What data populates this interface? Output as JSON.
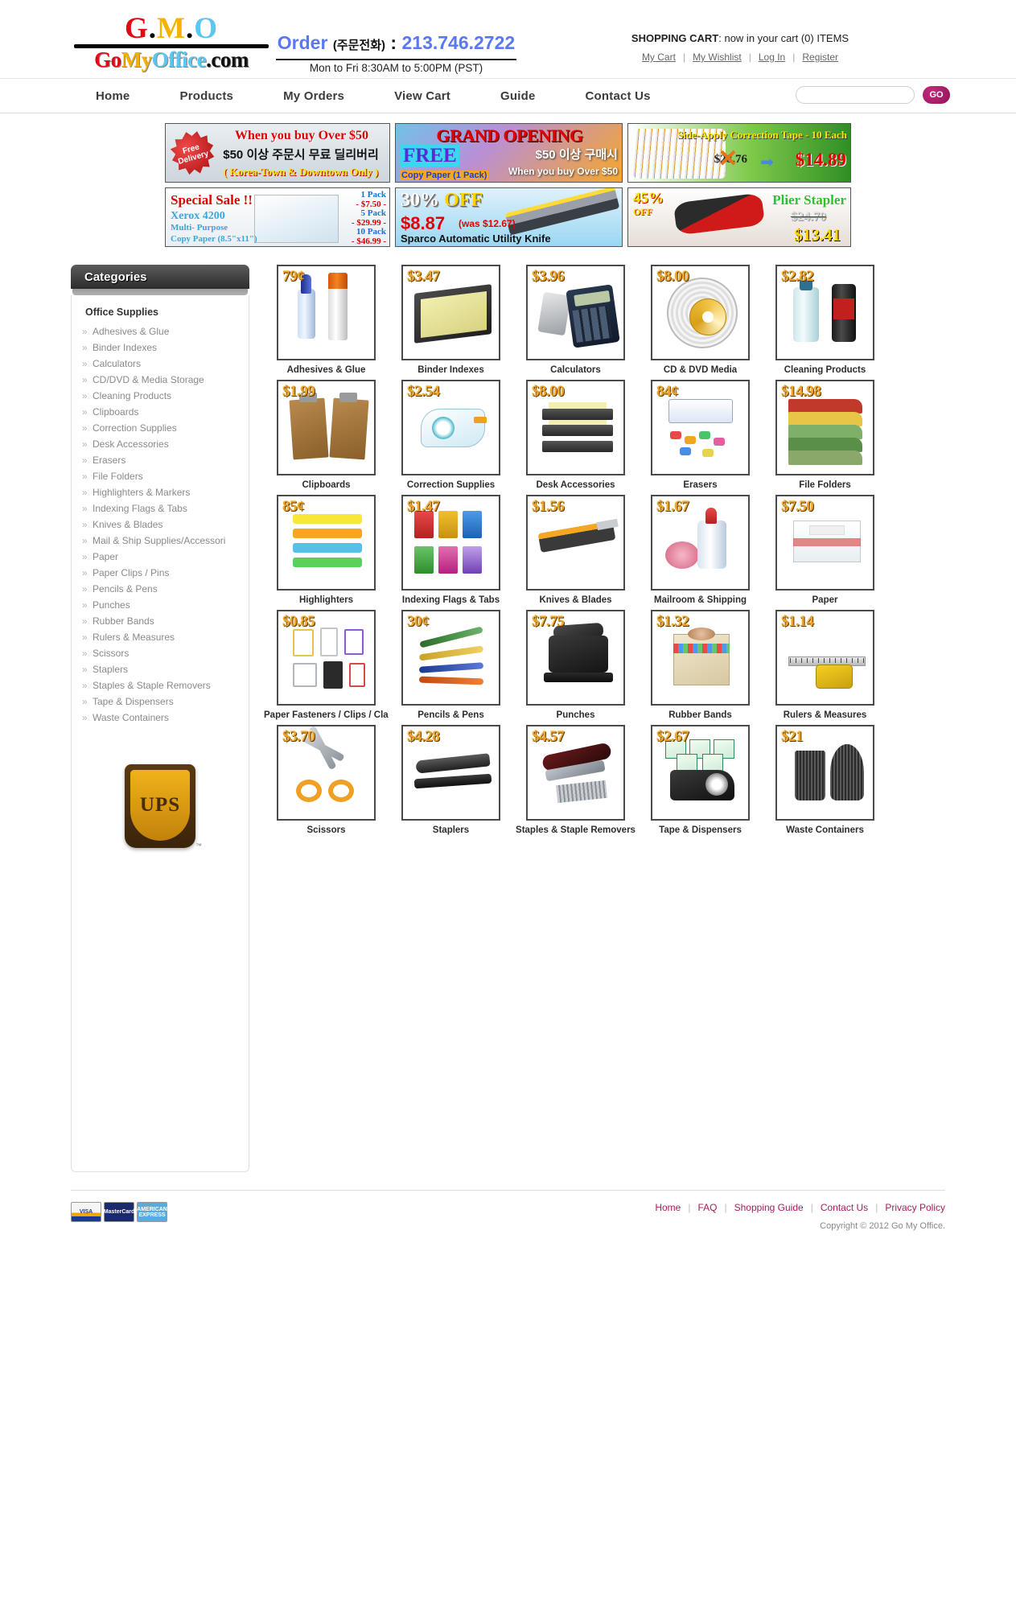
{
  "header": {
    "logo_top": "G.M.O",
    "logo_bottom": "GoMyOffice.com",
    "order_label": "Order",
    "order_korean": "(주문전화)",
    "order_colon": ":",
    "order_phone": "213.746.2722",
    "hours": "Mon to Fri  8:30AM to 5:00PM (PST)",
    "cart_label": "SHOPPING CART",
    "cart_text": ": now in your cart (0) ITEMS",
    "account_links": [
      "My Cart",
      "My Wishlist",
      "Log In",
      "Register"
    ]
  },
  "nav": {
    "items": [
      "Home",
      "Products",
      "My Orders",
      "View Cart",
      "Guide",
      "Contact Us"
    ],
    "search_placeholder": "",
    "search_value": "",
    "go_label": "GO"
  },
  "banners": {
    "free_delivery": {
      "badge": "Free Delivery",
      "line1": "When you buy Over $50",
      "line2": "$50 이상 주문시 무료 딜리버리",
      "line3": "( Korea-Town &  Downtown Only )"
    },
    "grand_opening": {
      "title": "GRAND OPENING",
      "free": "FREE",
      "sub": "Copy Paper (1 Pack)",
      "right1": "$50 이상 구매시",
      "right2": "When you buy Over $50"
    },
    "correction_tape": {
      "title": "Side-Apply Correction Tape - 10 Each",
      "old_price": "$28.76",
      "new_price": "$14.89"
    },
    "xerox": {
      "title": "Special Sale !!",
      "line1": "Xerox 4200",
      "line2": "Multi- Purpose",
      "line3": "Copy Paper (8.5\"x11\")",
      "packs": [
        "1 Pack",
        "- $7.50 -",
        "5 Pack",
        "- $29.99 -",
        "10 Pack",
        "- $46.99 -"
      ]
    },
    "utility_knife": {
      "percent": "30%",
      "off": "OFF",
      "price": "$8.87",
      "was": "(was $12.67)",
      "name": "Sparco Automatic Utility Knife"
    },
    "plier_stapler": {
      "percent": "45%",
      "off": "OFF",
      "title": "Plier Stapler",
      "old_price": "$24.70",
      "new_price": "$13.41"
    }
  },
  "sidebar": {
    "title": "Categories",
    "root": "Office Supplies",
    "chevron": "»",
    "items": [
      "Adhesives & Glue",
      "Binder Indexes",
      "Calculators",
      "CD/DVD & Media Storage",
      "Cleaning Products",
      "Clipboards",
      "Correction Supplies",
      "Desk Accessories",
      "Erasers",
      "File Folders",
      "Highlighters & Markers",
      "Indexing Flags & Tabs",
      "Knives & Blades",
      "Mail & Ship Supplies/Accessori",
      "Paper",
      "Paper Clips / Pins",
      "Pencils & Pens",
      "Punches",
      "Rubber Bands",
      "Rulers & Measures",
      "Scissors",
      "Staplers",
      "Staples & Staple Removers",
      "Tape & Dispensers",
      "Waste Containers"
    ],
    "shipping_logo": "UPS"
  },
  "products": [
    {
      "price": "79¢",
      "label": "Adhesives & Glue",
      "art": "glue"
    },
    {
      "price": "$3.47",
      "label": "Binder Indexes",
      "art": "binder"
    },
    {
      "price": "$3.96",
      "label": "Calculators",
      "art": "calc"
    },
    {
      "price": "$8.00",
      "label": "CD & DVD Media",
      "art": "cd"
    },
    {
      "price": "$2.82",
      "label": "Cleaning Products",
      "art": "clean"
    },
    {
      "price": "$1.99",
      "label": "Clipboards",
      "art": "clipboard"
    },
    {
      "price": "$2.54",
      "label": "Correction Supplies",
      "art": "correction"
    },
    {
      "price": "$8.00",
      "label": "Desk Accessories",
      "art": "tray"
    },
    {
      "price": "84¢",
      "label": "Erasers",
      "art": "eraser"
    },
    {
      "price": "$14.98",
      "label": "File Folders",
      "art": "folder"
    },
    {
      "price": "85¢",
      "label": "Highlighters",
      "art": "highlighter"
    },
    {
      "price": "$1.47",
      "label": "Indexing Flags & Tabs",
      "art": "flags"
    },
    {
      "price": "$1.56",
      "label": "Knives & Blades",
      "art": "knife"
    },
    {
      "price": "$1.67",
      "label": "Mailroom & Shipping",
      "art": "mailroom"
    },
    {
      "price": "$7.50",
      "label": "Paper",
      "art": "paper"
    },
    {
      "price": "$0.85",
      "label": "Paper Fasteners / Clips / Clam",
      "art": "fasteners"
    },
    {
      "price": "30¢",
      "label": "Pencils & Pens",
      "art": "pens"
    },
    {
      "price": "$7.75",
      "label": "Punches",
      "art": "punch"
    },
    {
      "price": "$1.32",
      "label": "Rubber Bands",
      "art": "rubber"
    },
    {
      "price": "$1.14",
      "label": "Rulers & Measures",
      "art": "ruler"
    },
    {
      "price": "$3.70",
      "label": "Scissors",
      "art": "scissors"
    },
    {
      "price": "$4.28",
      "label": "Staplers",
      "art": "stapler"
    },
    {
      "price": "$4.57",
      "label": "Staples & Staple Removers",
      "art": "remover"
    },
    {
      "price": "$2.67",
      "label": "Tape & Dispensers",
      "art": "tape"
    },
    {
      "price": "$21",
      "label": "Waste Containers",
      "art": "waste"
    }
  ],
  "footer": {
    "cards": [
      "VISA",
      "MasterCard",
      "AMERICAN EXPRESS"
    ],
    "links": [
      "Home",
      "FAQ",
      "Shopping Guide",
      "Contact Us",
      "Privacy Policy"
    ],
    "copyright": "Copyright © 2012 Go My Office."
  }
}
